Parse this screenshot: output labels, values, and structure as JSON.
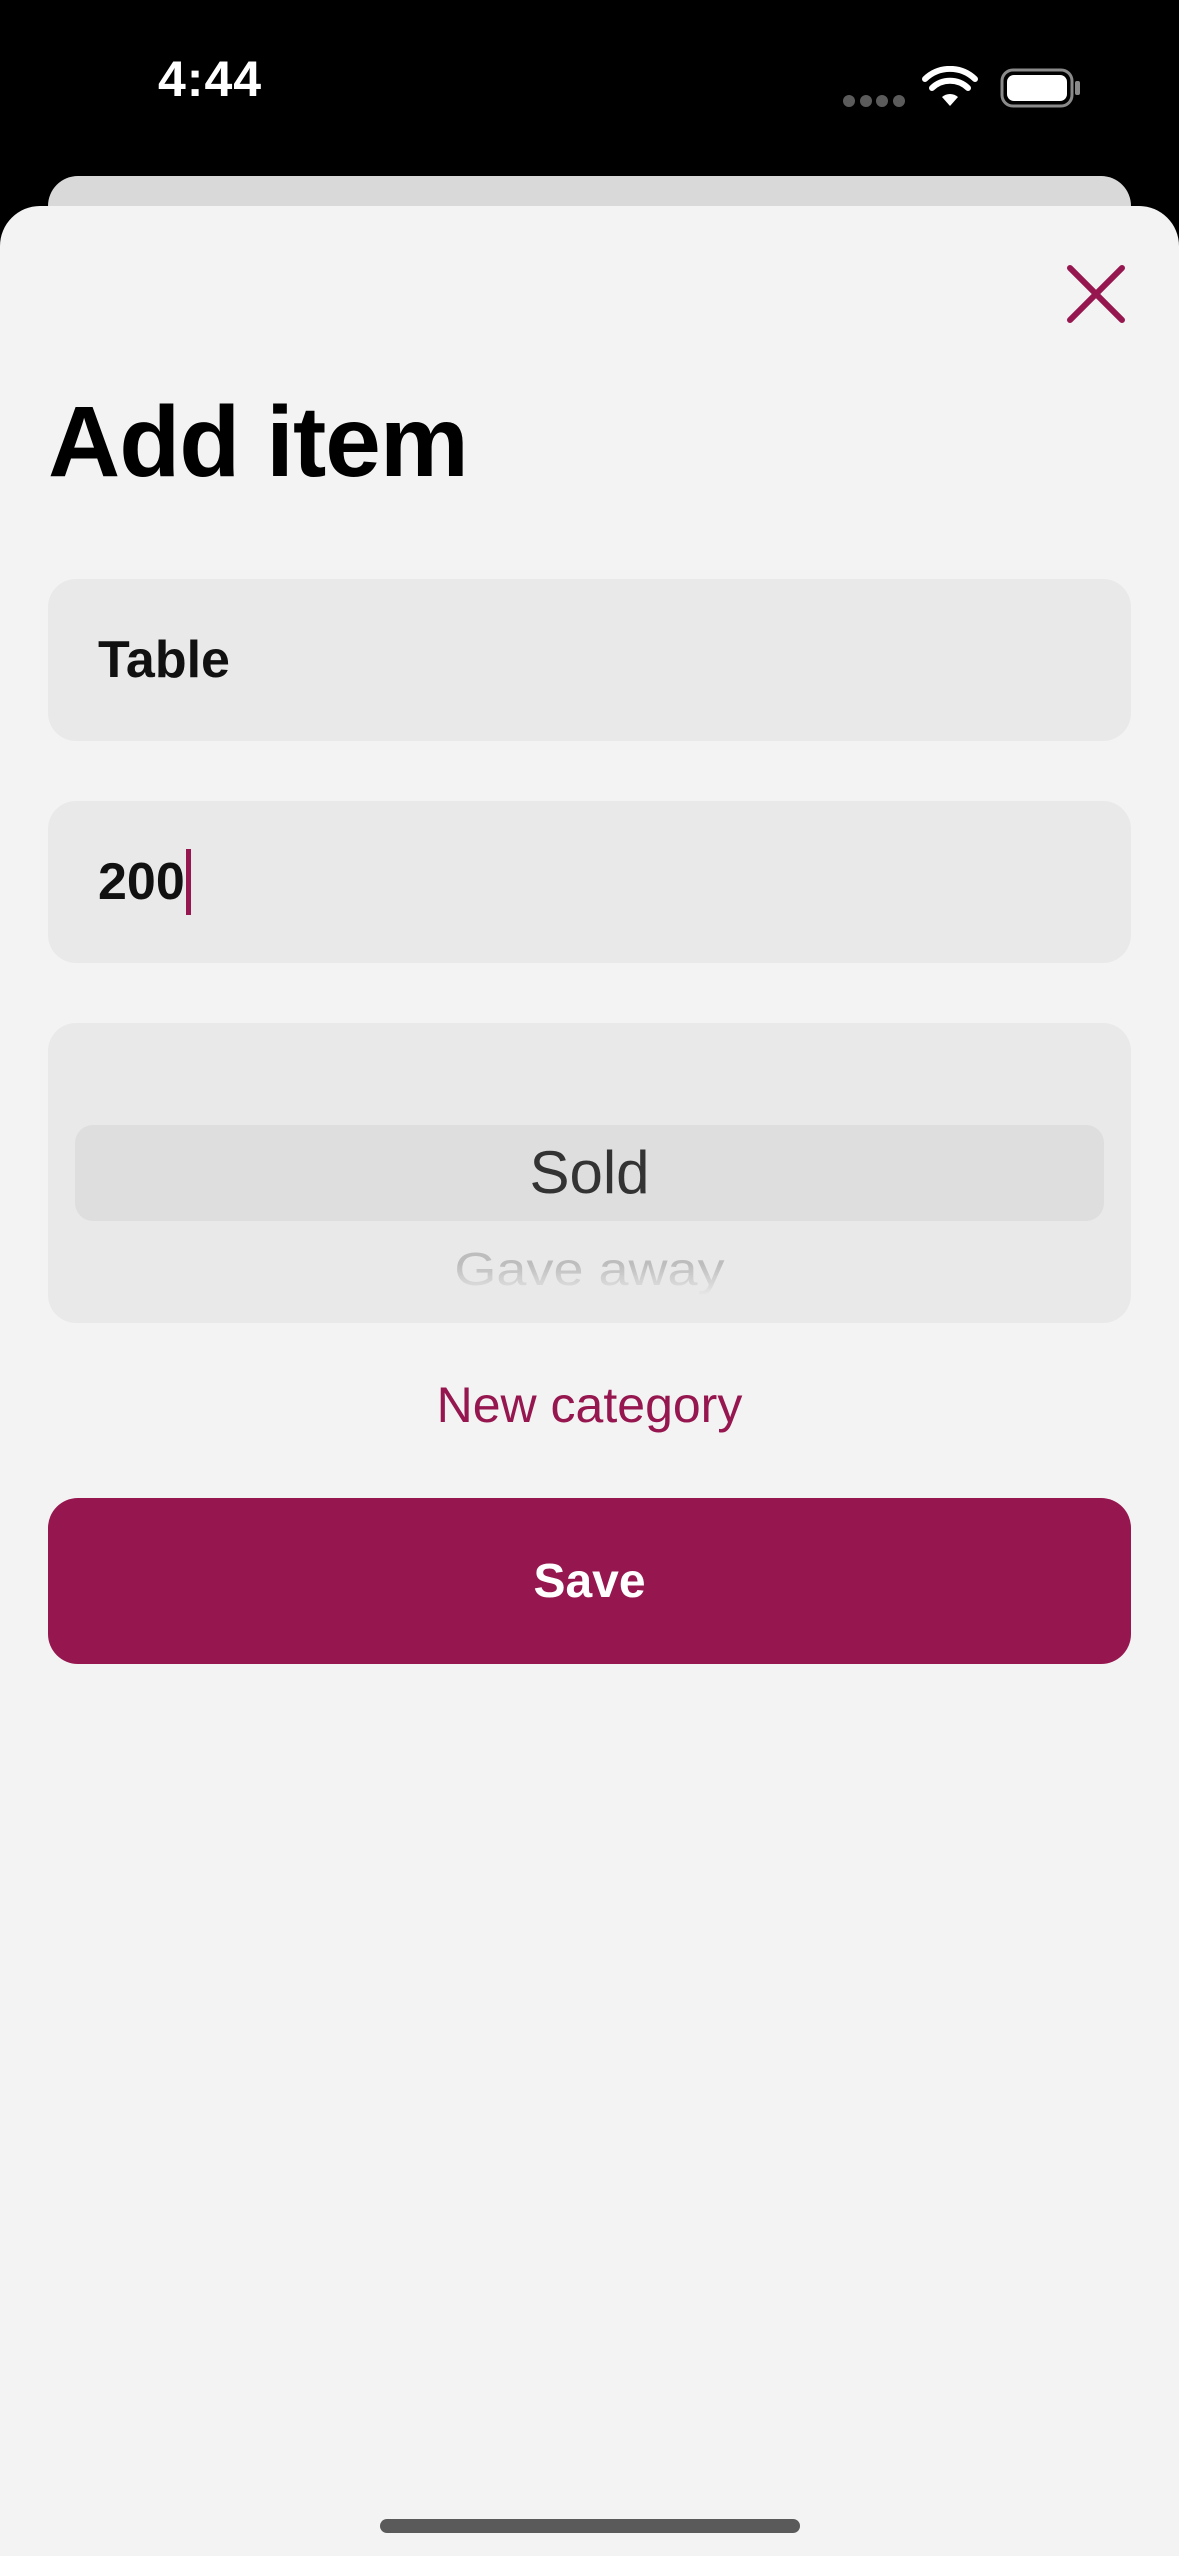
{
  "status_bar": {
    "time": "4:44"
  },
  "header": {
    "title": "Add item",
    "close_icon": "close-icon"
  },
  "form": {
    "name_value": "Table",
    "price_value": "200",
    "category_picker": {
      "selected": "Sold",
      "next": "Gave away"
    },
    "new_category_label": "New category",
    "save_label": "Save"
  },
  "colors": {
    "accent": "#96174f",
    "sheet_background": "#f3f3f3",
    "field_background": "#e9e9e9"
  }
}
